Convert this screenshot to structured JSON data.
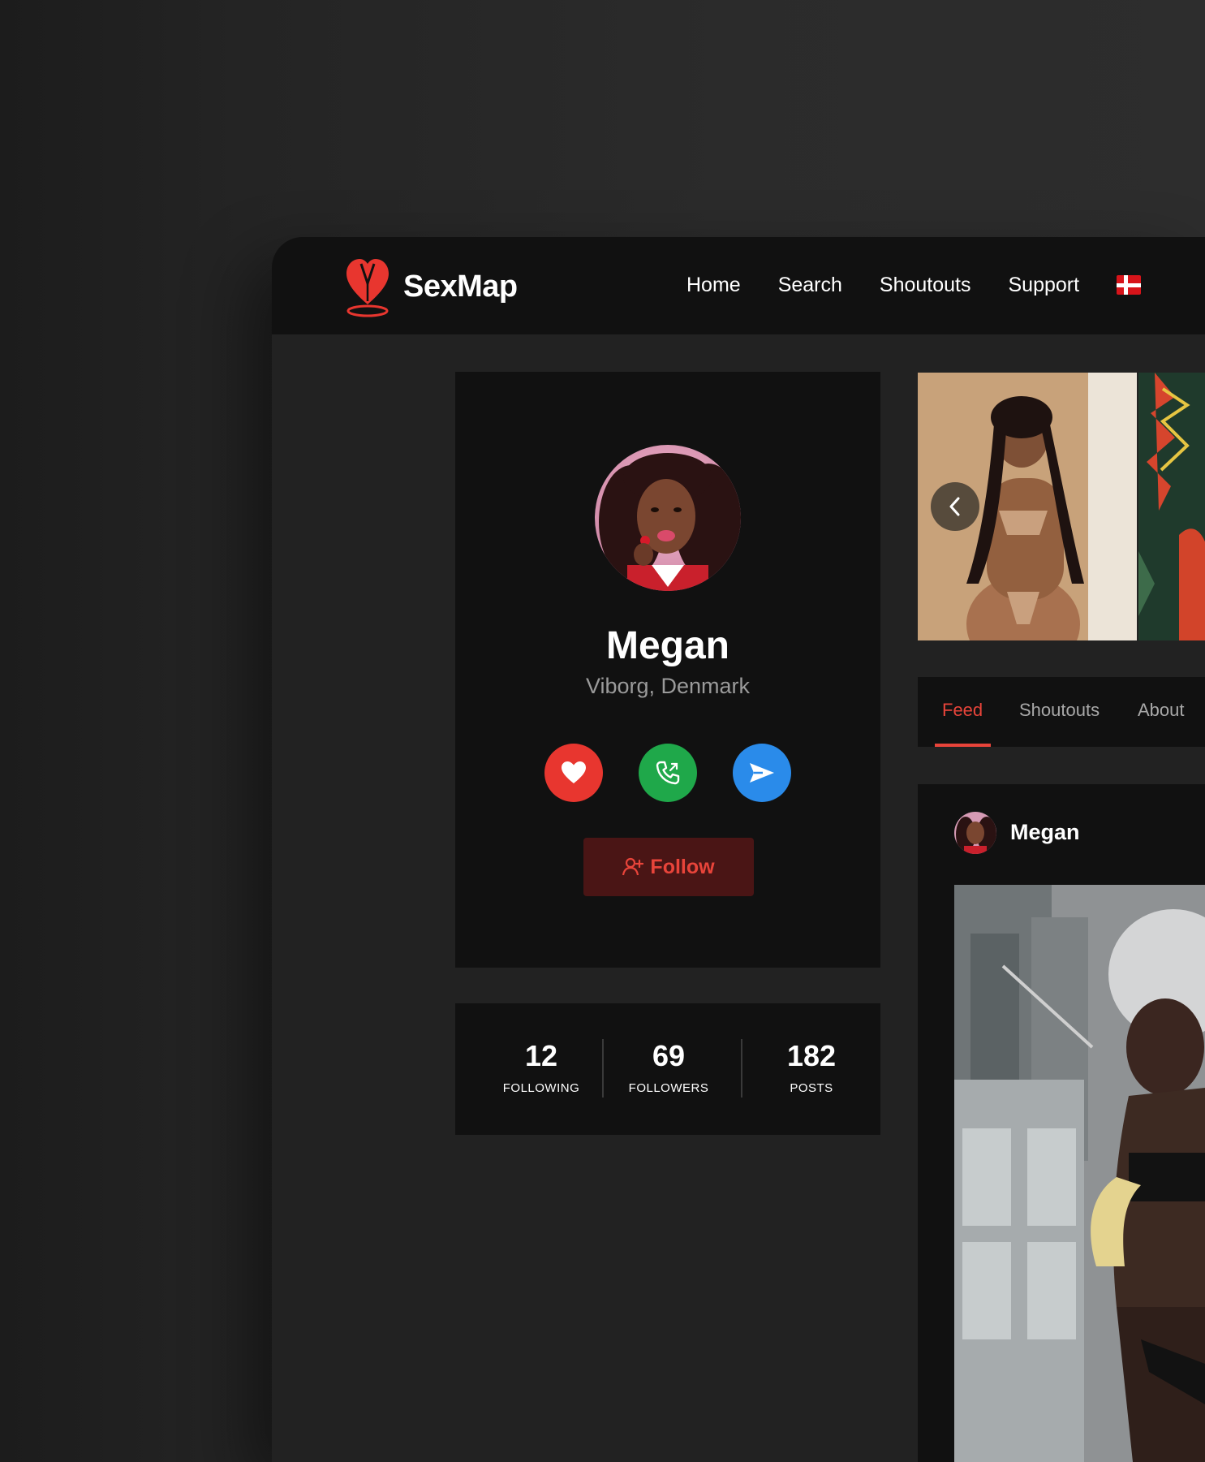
{
  "app": {
    "brand": "SexMap",
    "accent_color": "#e8362f"
  },
  "nav": {
    "items": [
      {
        "label": "Home"
      },
      {
        "label": "Search"
      },
      {
        "label": "Shoutouts"
      },
      {
        "label": "Support"
      }
    ],
    "language_icon": "denmark-flag-icon"
  },
  "profile": {
    "name": "Megan",
    "location": "Viborg, Denmark",
    "actions": [
      {
        "icon": "heart-icon",
        "color": "#e8362f"
      },
      {
        "icon": "phone-icon",
        "color": "#1fa84a"
      },
      {
        "icon": "send-icon",
        "color": "#2a8bea"
      }
    ],
    "follow_label": "Follow",
    "follow_icon": "user-plus-icon"
  },
  "stats": [
    {
      "value": "12",
      "label": "FOLLOWING"
    },
    {
      "value": "69",
      "label": "FOLLOWERS"
    },
    {
      "value": "182",
      "label": "POSTS"
    }
  ],
  "gallery": {
    "prev_icon": "chevron-left-icon"
  },
  "tabs": [
    {
      "label": "Feed",
      "active": true
    },
    {
      "label": "Shoutouts",
      "active": false
    },
    {
      "label": "About",
      "active": false
    }
  ],
  "feed": {
    "post": {
      "author": "Megan"
    }
  }
}
